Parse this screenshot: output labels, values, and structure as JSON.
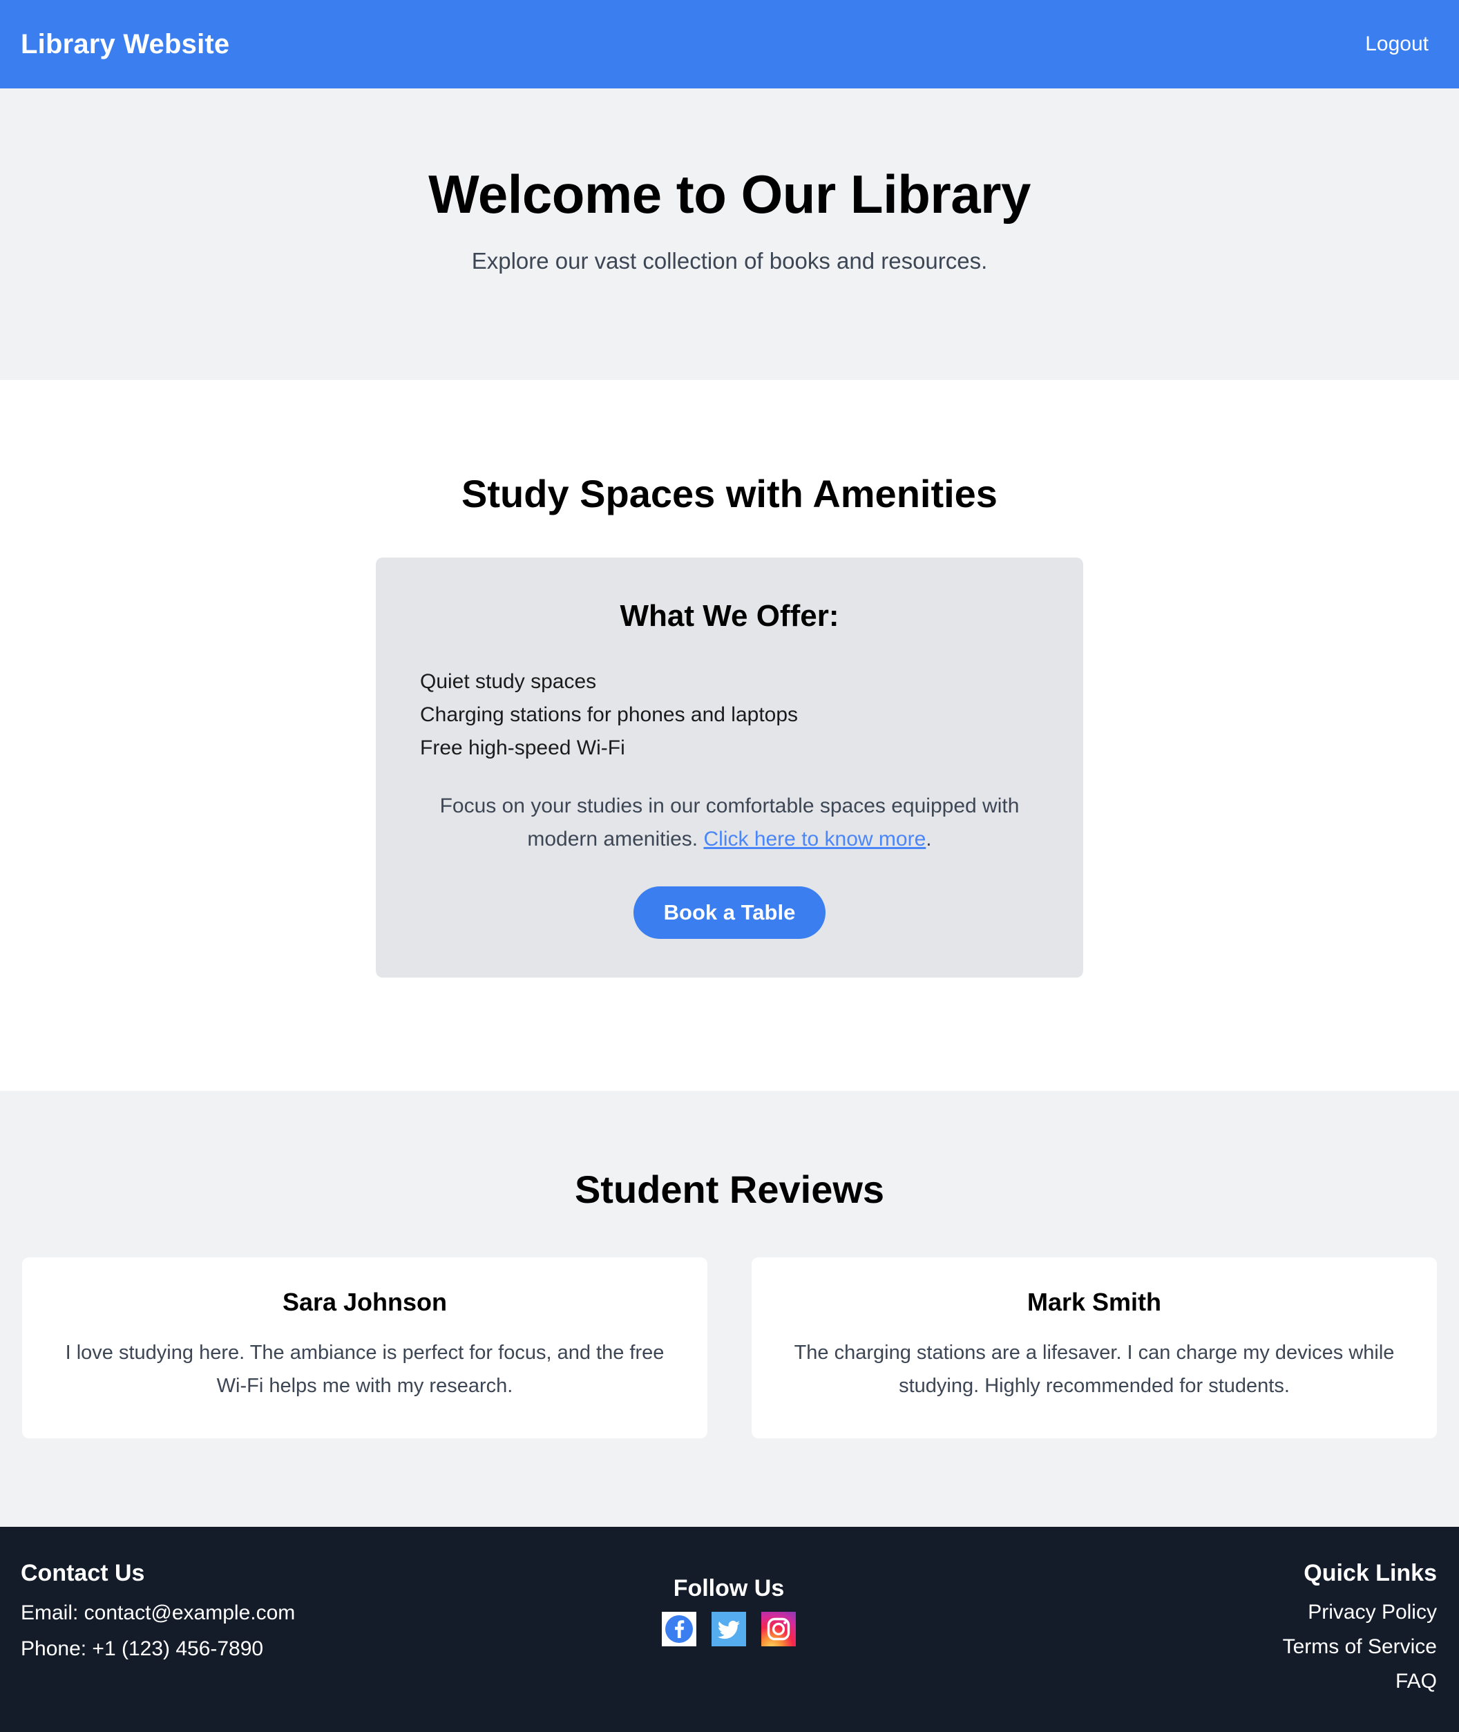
{
  "navbar": {
    "brand": "Library Website",
    "logout_label": "Logout"
  },
  "hero": {
    "title": "Welcome to Our Library",
    "subtitle": "Explore our vast collection of books and resources."
  },
  "amenities": {
    "section_title": "Study Spaces with Amenities",
    "card_title": "What We Offer:",
    "items": [
      "Quiet study spaces",
      "Charging stations for phones and laptops",
      "Free high-speed Wi-Fi"
    ],
    "description_before": "Focus on your studies in our comfortable spaces equipped with modern amenities. ",
    "link_text": "Click here to know more",
    "description_after": ".",
    "book_button": "Book a Table"
  },
  "reviews": {
    "section_title": "Student Reviews",
    "cards": [
      {
        "name": "Sara Johnson",
        "text": "I love studying here. The ambiance is perfect for focus, and the free Wi-Fi helps me with my research."
      },
      {
        "name": "Mark Smith",
        "text": "The charging stations are a lifesaver. I can charge my devices while studying. Highly recommended for students."
      }
    ]
  },
  "footer": {
    "contact_heading": "Contact Us",
    "email_line": "Email: contact@example.com",
    "phone_line": "Phone: +1 (123) 456-7890",
    "follow_heading": "Follow Us",
    "social": [
      {
        "name": "facebook-icon"
      },
      {
        "name": "twitter-icon"
      },
      {
        "name": "instagram-icon"
      }
    ],
    "quick_links_heading": "Quick Links",
    "quick_links": [
      "Privacy Policy",
      "Terms of Service",
      "FAQ"
    ]
  },
  "colors": {
    "brand_blue": "#3b7ef0",
    "link_blue": "#4a86f7",
    "footer_bg": "#141b29",
    "section_gray": "#f1f2f4",
    "card_gray": "#e4e5e9"
  }
}
